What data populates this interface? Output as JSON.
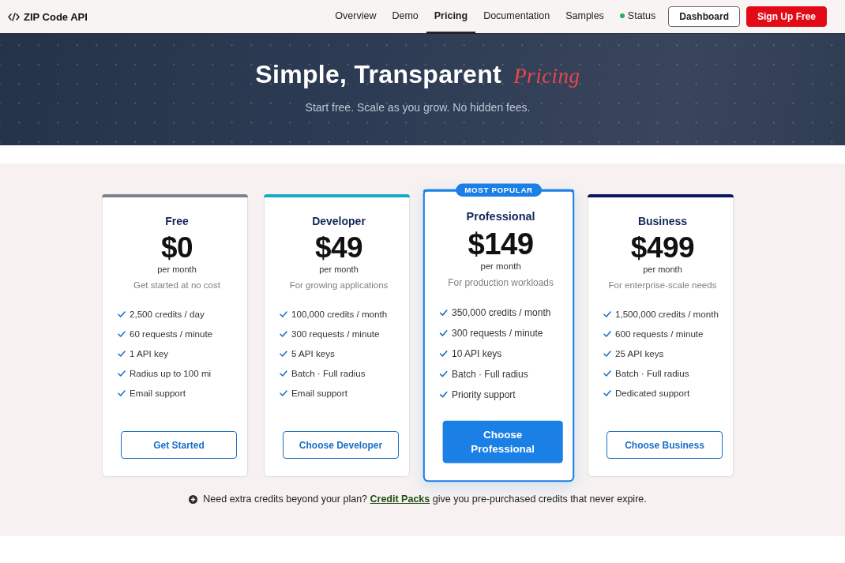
{
  "brand": {
    "name": "ZIP Code API"
  },
  "nav": {
    "links": [
      {
        "label": "Overview",
        "selected": false
      },
      {
        "label": "Demo",
        "selected": false
      },
      {
        "label": "Pricing",
        "selected": true
      },
      {
        "label": "Documentation",
        "selected": false
      },
      {
        "label": "Samples",
        "selected": false
      }
    ],
    "status": {
      "label": "Status",
      "online": true
    },
    "buttons": [
      {
        "label": "Dashboard",
        "kind": "outline"
      },
      {
        "label": "Sign Up Free",
        "kind": "primary"
      }
    ]
  },
  "hero": {
    "title": "Simple, Transparent *Pricing*",
    "subtitle": "Start free. Scale as you grow. No hidden fees."
  },
  "plans": [
    {
      "name": "Free",
      "color": "#7c838f",
      "featured": false,
      "price": "$0",
      "period": "per month",
      "tagline": "Get started at no cost",
      "features": [
        "2,500 credits / day",
        "60 requests / minute",
        "1 API key",
        "Radius up to 100 mi",
        "Email support"
      ],
      "cta": "Get Started"
    },
    {
      "name": "Developer",
      "color": "#14a9c9",
      "featured": false,
      "price": "$49",
      "period": "per month",
      "tagline": "For growing applications",
      "features": [
        "100,000 credits / month",
        "300 requests / minute",
        "5 API keys",
        "Batch · Full radius",
        "Email support"
      ],
      "cta": "Choose Developer"
    },
    {
      "name": "Professional",
      "color": "#1a80e6",
      "featured": true,
      "badge": "MOST POPULAR",
      "price": "$149",
      "period": "per month",
      "tagline": "For production workloads",
      "features": [
        "350,000 credits / month",
        "300 requests / minute",
        "10 API keys",
        "Batch · Full radius",
        "Priority support"
      ],
      "cta": "Choose Professional"
    },
    {
      "name": "Business",
      "color": "#0b1760",
      "featured": false,
      "price": "$499",
      "period": "per month",
      "tagline": "For enterprise-scale needs",
      "features": [
        "1,500,000 credits / month",
        "600 requests / minute",
        "25 API keys",
        "Batch · Full radius",
        "Dedicated support"
      ],
      "cta": "Choose Business"
    }
  ],
  "note": {
    "before": "Need extra credits beyond your plan?",
    "link": "Credit Packs",
    "after": "give you pre-purchased credits that never expire."
  }
}
